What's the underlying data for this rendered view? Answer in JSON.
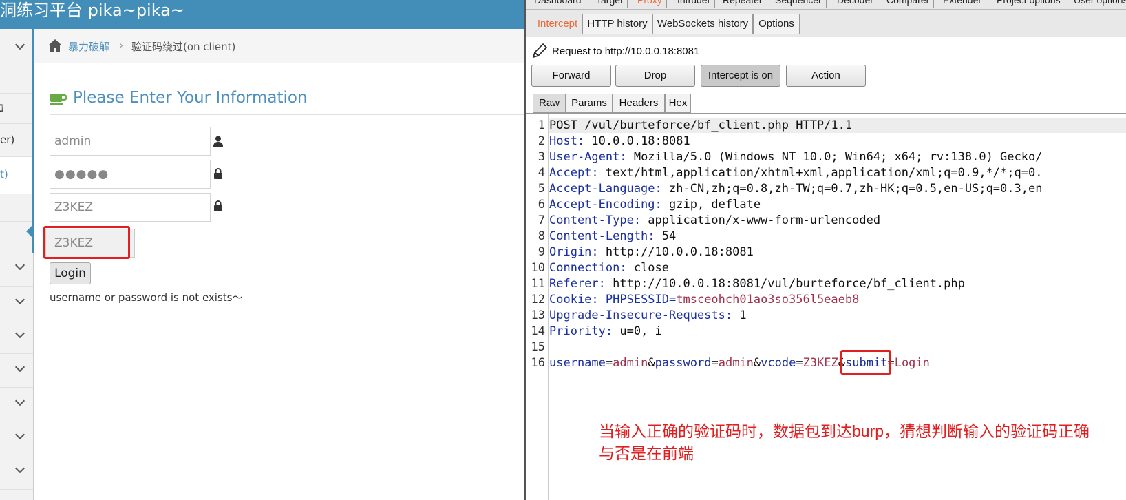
{
  "site": {
    "title": "洞练习平台 pika~pika~",
    "sidebar_fragments": [
      "ℷ",
      "er)",
      "t)"
    ],
    "breadcrumb": {
      "home": "暴力破解",
      "separator": "›",
      "current": "验证码绕过(on client)"
    },
    "form": {
      "title": "Please Enter Your Information",
      "username_value": "admin",
      "password_value": "●●●●●",
      "vcode_value": "Z3KEZ",
      "vcode_display": "Z3KEZ",
      "login_label": "Login",
      "error_message": "username or password is not exists～"
    }
  },
  "burp": {
    "top_tabs": [
      "Dashboard",
      "Target",
      "Proxy",
      "Intruder",
      "Repeater",
      "Sequencer",
      "Decoder",
      "Comparer",
      "Extender",
      "Project options",
      "User options"
    ],
    "proxy_tabs": [
      "Intercept",
      "HTTP history",
      "WebSockets history",
      "Options"
    ],
    "active_proxy_tab": "Intercept",
    "request_to": "Request to http://10.0.0.18:8081",
    "buttons": {
      "forward": "Forward",
      "drop": "Drop",
      "intercept": "Intercept is on",
      "action": "Action"
    },
    "editor_tabs": [
      "Raw",
      "Params",
      "Headers",
      "Hex"
    ],
    "line_numbers": [
      "1",
      "2",
      "3",
      "4",
      "5",
      "6",
      "7",
      "8",
      "9",
      "10",
      "11",
      "12",
      "13",
      "14",
      "15",
      "16"
    ],
    "request_lines": [
      {
        "key": "POST /vul/burteforce/bf_client.php HTTP/1.1",
        "val": ""
      },
      {
        "key": "Host:",
        "val": " 10.0.0.18:8081"
      },
      {
        "key": "User-Agent:",
        "val": " Mozilla/5.0 (Windows NT 10.0; Win64; x64; rv:138.0) Gecko/"
      },
      {
        "key": "Accept:",
        "val": " text/html,application/xhtml+xml,application/xml;q=0.9,*/*;q=0."
      },
      {
        "key": "Accept-Language:",
        "val": " zh-CN,zh;q=0.8,zh-TW;q=0.7,zh-HK;q=0.5,en-US;q=0.3,en"
      },
      {
        "key": "Accept-Encoding:",
        "val": " gzip, deflate"
      },
      {
        "key": "Content-Type:",
        "val": " application/x-www-form-urlencoded"
      },
      {
        "key": "Content-Length:",
        "val": " 54"
      },
      {
        "key": "Origin:",
        "val": " http://10.0.0.18:8081"
      },
      {
        "key": "Connection:",
        "val": " close"
      },
      {
        "key": "Referer:",
        "val": " http://10.0.0.18:8081/vul/burteforce/bf_client.php"
      },
      {
        "key": "Cookie:",
        "val": " PHPSESSID=",
        "val2": "tmsceohch01ao3so356l5eaeb8"
      },
      {
        "key": "Upgrade-Insecure-Requests:",
        "val": " 1"
      },
      {
        "key": "Priority:",
        "val": " u=0, i"
      },
      {
        "key": "",
        "val": ""
      },
      {
        "key": "",
        "val": ""
      }
    ],
    "body_params": {
      "p1": "username",
      "v1": "admin",
      "p2": "password",
      "v2": "admin",
      "p3": "vcode",
      "v3": "Z3KEZ",
      "p4": "submit",
      "v4": "Login"
    },
    "annotation": "当输入正确的验证码时，数据包到达burp，猜想判断输入的验证码正确与否是在前端"
  },
  "colors": {
    "accent_blue": "#438eb9",
    "highlight_red": "#e02020",
    "burp_orange": "#e86a3c"
  }
}
